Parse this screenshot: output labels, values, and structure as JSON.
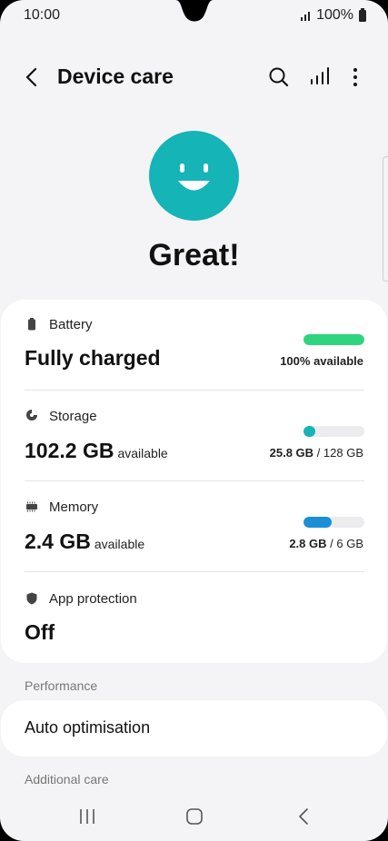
{
  "status_bar": {
    "time": "10:00",
    "battery_text": "100%"
  },
  "app_bar": {
    "title": "Device care"
  },
  "hero": {
    "status": "Great!",
    "face_color": "#14b4b7"
  },
  "battery": {
    "label": "Battery",
    "value": "Fully charged",
    "caption": "100% available",
    "fill_fraction": 1.0,
    "bar_color": "#2fd47f"
  },
  "storage": {
    "label": "Storage",
    "value": "102.2 GB",
    "suffix": "available",
    "used": "25.8 GB",
    "total": "/ 128 GB",
    "fill_fraction": 0.2,
    "bar_color": "#14b4b7"
  },
  "memory": {
    "label": "Memory",
    "value": "2.4 GB",
    "suffix": "available",
    "used": "2.8 GB",
    "total": "/ 6 GB",
    "fill_fraction": 0.47,
    "bar_color": "#1a8fd6"
  },
  "app_protection": {
    "label": "App protection",
    "value": "Off"
  },
  "performance": {
    "header": "Performance",
    "auto_optimisation": "Auto optimisation"
  },
  "additional_care": {
    "header": "Additional care"
  }
}
